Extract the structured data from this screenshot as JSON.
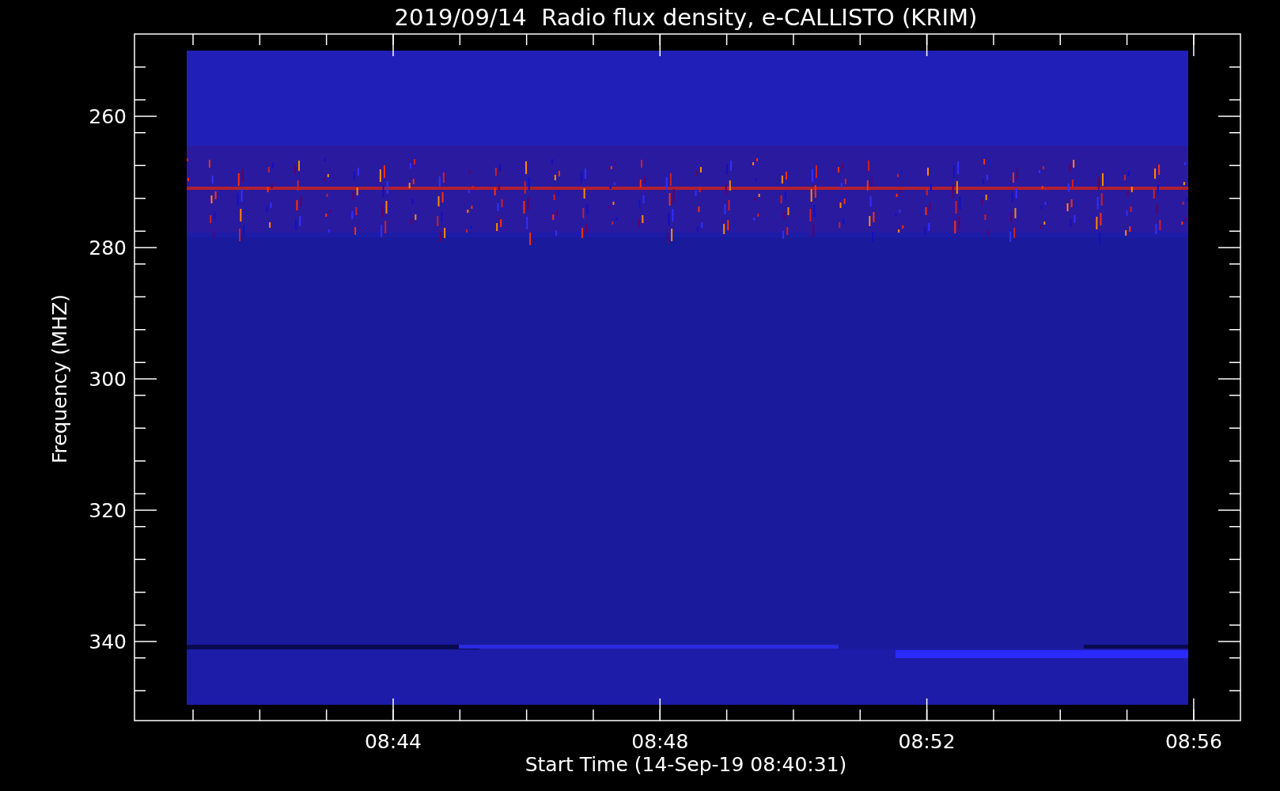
{
  "title": "2019/09/14  Radio flux density, e-CALLISTO (KRIM)",
  "y_axis": {
    "label": "Frequency (MHZ)",
    "ticks": [
      "260",
      "280",
      "300",
      "320",
      "340"
    ]
  },
  "x_axis": {
    "label": "Start Time (14-Sep-19 08:40:31)",
    "ticks": [
      "08:44",
      "08:48",
      "08:52",
      "08:56"
    ]
  }
}
